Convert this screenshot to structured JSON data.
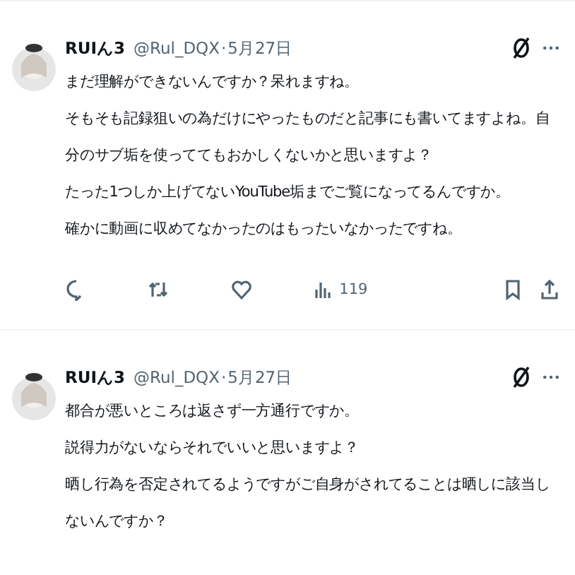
{
  "tweets": [
    {
      "display_name": "RUIん3",
      "handle": "@Rul_DQX",
      "separator": "·",
      "date": "5月27日",
      "paragraphs": [
        "まだ理解ができないんですか？呆れますね。",
        "そもそも記録狙いの為だけにやったものだと記事にも書いてますよね。自分のサブ垢を使っててもおかしくないかと思いますよ？",
        "たった1つしか上げてないYouTube垢までご覧になってるんですか。",
        "確かに動画に収めてなかったのはもったいなかったですね。"
      ],
      "views": "119"
    },
    {
      "display_name": "RUIん3",
      "handle": "@Rul_DQX",
      "separator": "·",
      "date": "5月27日",
      "paragraphs": [
        "都合が悪いところは返さず一方通行ですか。",
        "説得力がないならそれでいいと思いますよ？",
        "晒し行為を否定されてるようですがご自身がされてることは晒しに該当しないんですか？"
      ]
    }
  ]
}
